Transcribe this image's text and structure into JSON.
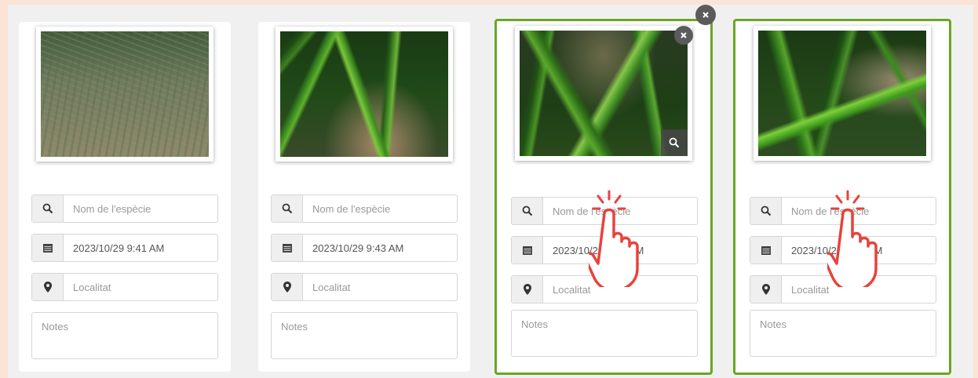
{
  "cards": [
    {
      "species_placeholder": "Nom de l'espècie",
      "datetime": "2023/10/29 9:41 AM",
      "location_placeholder": "Localitat",
      "notes_placeholder": "Notes",
      "selected": false
    },
    {
      "species_placeholder": "Nom de l'espècie",
      "datetime": "2023/10/29 9:43 AM",
      "location_placeholder": "Localitat",
      "notes_placeholder": "Notes",
      "selected": false
    },
    {
      "species_placeholder": "Nom de l'espècie",
      "datetime": "2023/10/29 9:43 AM",
      "location_placeholder": "Localitat",
      "notes_placeholder": "Notes",
      "selected": true
    },
    {
      "species_placeholder": "Nom de l'espècie",
      "datetime": "2023/10/29 9:43 AM",
      "location_placeholder": "Localitat",
      "notes_placeholder": "Notes",
      "selected": true
    }
  ],
  "icons": {
    "search": "search-icon",
    "calendar": "calendar-icon",
    "location": "map-marker-icon",
    "close": "close-icon",
    "zoom": "zoom-icon",
    "pointer": "tap-hand-icon"
  },
  "colors": {
    "background": "#fbe3d6",
    "panel": "#f0f0f0",
    "selected_border": "#6aa622",
    "pointer": "#e8423c"
  }
}
